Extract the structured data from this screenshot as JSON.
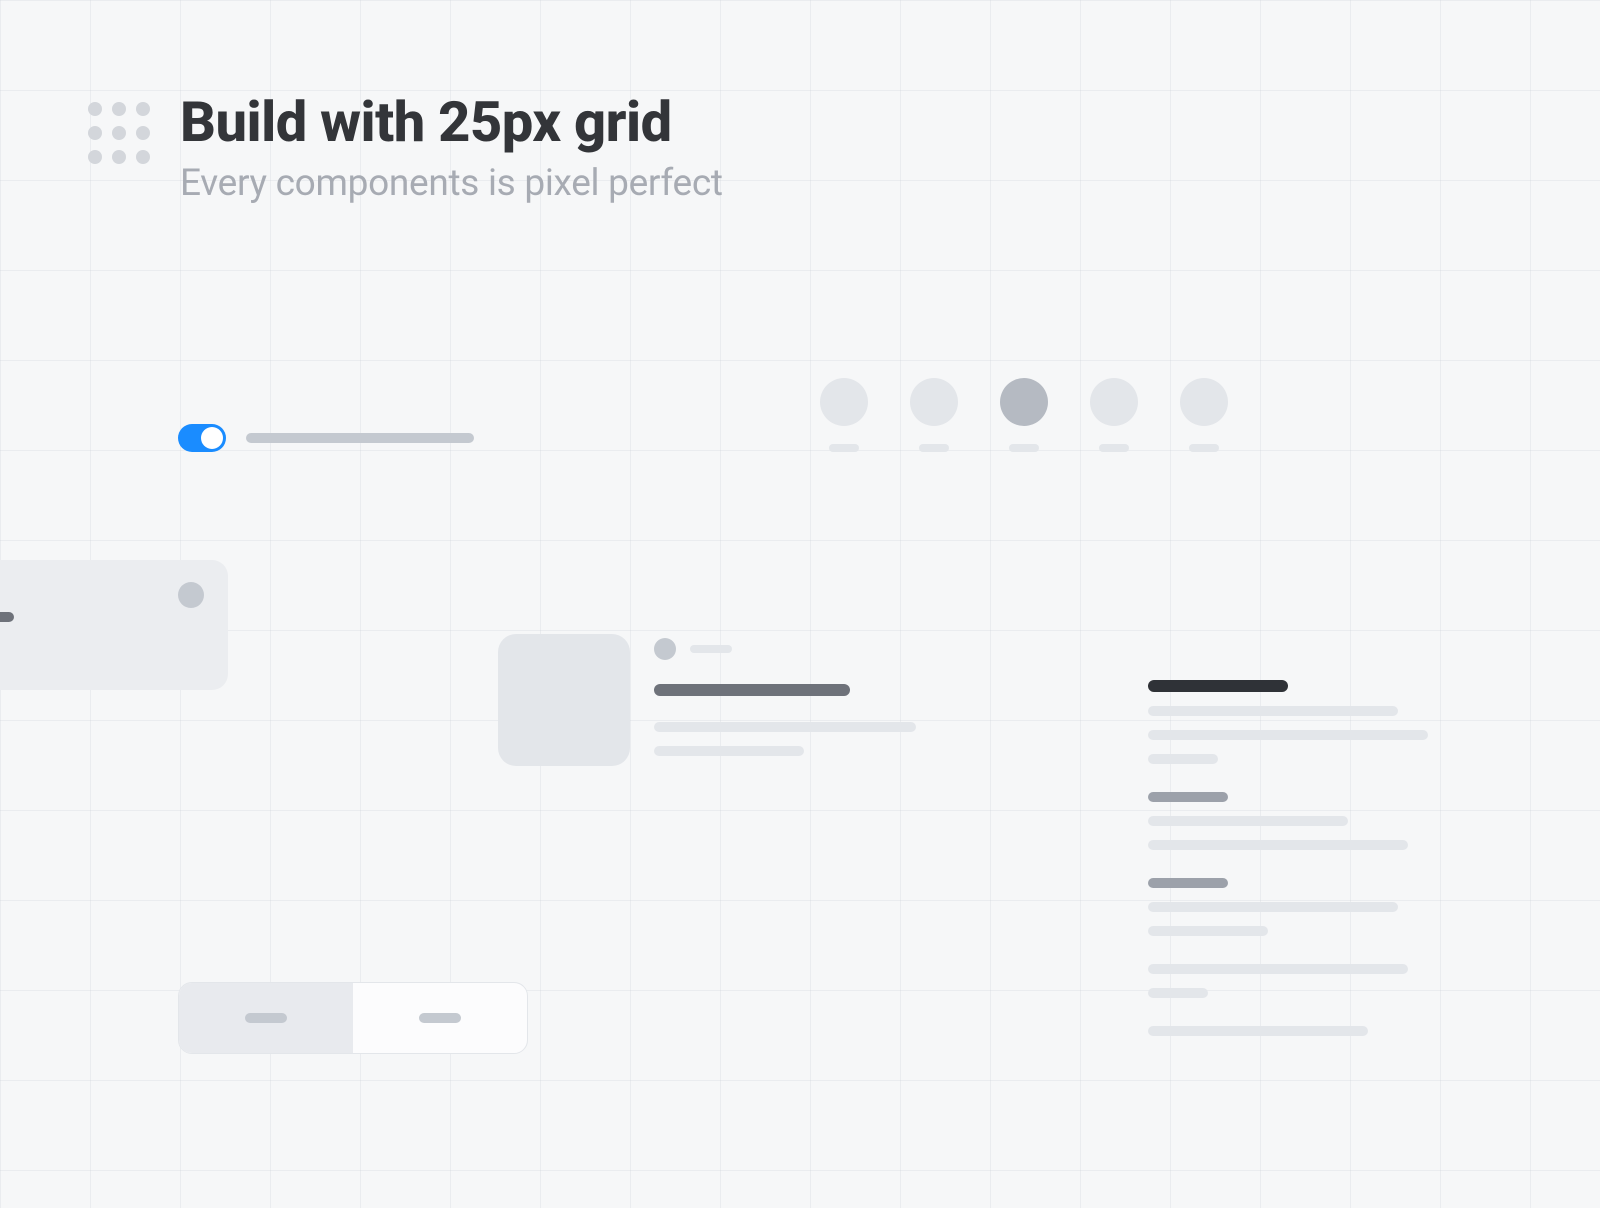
{
  "header": {
    "title": "Build with 25px grid",
    "subtitle": "Every components is pixel perfect"
  },
  "colors": {
    "accent": "#1a8cff",
    "text_dark": "#333539",
    "text_muted": "#a7abb3",
    "placeholder_dark": "#6e727a",
    "placeholder_mid": "#c4c9d0",
    "placeholder_light": "#e3e6ea",
    "surface": "#ebedf0",
    "bg": "#f6f7f8"
  },
  "components": {
    "toggle": {
      "state": "on"
    },
    "avatars": {
      "count": 5,
      "active_index": 2
    },
    "segmented": {
      "options": 2,
      "selected_index": 0
    }
  }
}
